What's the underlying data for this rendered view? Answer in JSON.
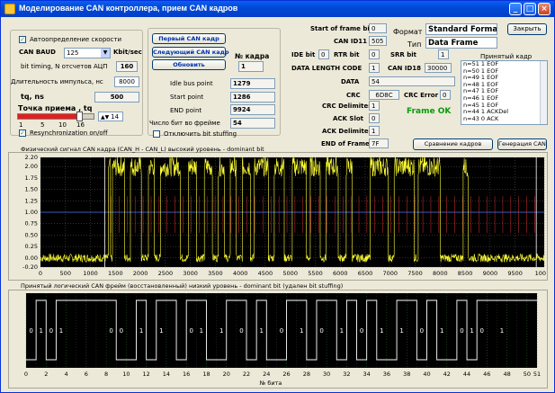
{
  "window": {
    "title": "Моделирование CAN контроллера, прием CAN кадров",
    "controls": {
      "minimize": "_",
      "maximize": "□",
      "close": "×"
    }
  },
  "left_panel": {
    "auto_speed_label": "Автоопределение скорости",
    "auto_speed_checked": true,
    "baud_label": "CAN BAUD",
    "baud_value": "125",
    "baud_unit": "Kbit/sec",
    "bit_timing_label": "bit timing, N отсчетов АЦП",
    "bit_timing_value": "160",
    "pulse_len_label": "Длительность импульса, нс",
    "pulse_len_value": "8000",
    "tq_label": "tq, ns",
    "tq_value": "500",
    "sample_point_label": "Точка приема , tq",
    "sample_point_value": "14",
    "slider_fraction": 0.81,
    "slider_ticks": [
      "1",
      "5",
      "10",
      "16"
    ],
    "resync_label": "Resynchronization on/off",
    "resync_checked": true
  },
  "frame_nav": {
    "first_frame": "Первый CAN кадр",
    "next_frame": "Следующий CAN кадр",
    "refresh": "Обновить",
    "frame_no_label": "№ кадра",
    "frame_no_value": "1",
    "idle_label": "Idle bus point",
    "idle_value": "1279",
    "start_label": "Start point",
    "start_value": "1286",
    "end_label": "END point",
    "end_value": "9924",
    "stuff_count_label": "Число бит во фрейме",
    "stuff_count_value": "54",
    "disable_stuffing_label": "Отключить bit stuffing",
    "disable_stuffing_checked": false
  },
  "frame_fields": {
    "sof_label": "Start of frame bit",
    "sof_value": "0",
    "id11_label": "CAN ID11",
    "id11_value": "505",
    "ide_label": "IDE bit",
    "ide_value": "0",
    "rtr_label": "RTR bit",
    "rtr_value": "0",
    "srr_label": "SRR bit",
    "srr_value": "1",
    "dlc_label": "DATA LENGTH CODE",
    "dlc_value": "1",
    "id18_label": "CAN ID18",
    "id18_value": "30000",
    "data_label": "DATA",
    "data_value": "54",
    "crc_label": "CRC",
    "crc_value": "6D8C",
    "crc_error_label": "CRC Error",
    "crc_error_value": "0",
    "crc_delim_label": "CRC Delimiter",
    "crc_delim_value": "1",
    "ack_slot_label": "ACK Slot",
    "ack_slot_value": "0",
    "ack_delim_label": "ACK Delimiter",
    "ack_delim_value": "1",
    "eof_label": "END of Frame",
    "eof_value": "7F",
    "format_label": "Формат",
    "format_value": "Standard Format",
    "type_label": "Тип",
    "type_value": "Data Frame",
    "status": "Frame OK"
  },
  "right_panel": {
    "close_button": "Закрыть",
    "received_label": "Принятый кадр",
    "received_rows": [
      "n=51 1 EOF",
      "n=50 1 EOF",
      "n=49 1 EOF",
      "n=48 1 EOF",
      "n=47 1 EOF",
      "n=46 1 EOF",
      "n=45 1 EOF",
      "n=44 1 ACKDel",
      "n=43 0 ACK"
    ],
    "compare_button": "Сравнение кадров",
    "generate_button": "Генерация CAN"
  },
  "chart_data": [
    {
      "type": "line",
      "title": "Физический сигнал  CAN кадра (CAN_H - CAN_L)  высокий уровень - dominant bit",
      "x_ticks": [
        "0",
        "500",
        "1000",
        "1500",
        "2000",
        "2500",
        "3000",
        "3500",
        "4000",
        "4500",
        "5000",
        "5500",
        "6000",
        "6500",
        "7000",
        "7500",
        "8000",
        "8500",
        "9000",
        "9500",
        "10083"
      ],
      "y_ticks": [
        "2.20",
        "2.00",
        "1.75",
        "1.50",
        "1.25",
        "1.00",
        "0.75",
        "0.50",
        "0.25",
        "0.00",
        "-0.20"
      ],
      "xlim": [
        0,
        10083
      ],
      "ylim": [
        -0.2,
        2.2
      ],
      "dominant_level": 2.0,
      "recessive_level": 0.0,
      "threshold_level": 1.0,
      "segments": [
        [
          0,
          0
        ],
        [
          1360,
          2
        ],
        [
          1400,
          0
        ],
        [
          1440,
          2
        ],
        [
          1680,
          0
        ],
        [
          1800,
          2
        ],
        [
          2020,
          0
        ],
        [
          2160,
          2
        ],
        [
          2280,
          0
        ],
        [
          2400,
          2
        ],
        [
          2800,
          0
        ],
        [
          2960,
          2
        ],
        [
          3120,
          0
        ],
        [
          3280,
          2
        ],
        [
          3440,
          0
        ],
        [
          3560,
          2
        ],
        [
          3680,
          0
        ],
        [
          3800,
          2
        ],
        [
          3920,
          0
        ],
        [
          4040,
          2
        ],
        [
          4200,
          0
        ],
        [
          4280,
          2
        ],
        [
          4560,
          0
        ],
        [
          4680,
          2
        ],
        [
          4880,
          0
        ],
        [
          5040,
          2
        ],
        [
          5320,
          0
        ],
        [
          5400,
          2
        ],
        [
          5600,
          0
        ],
        [
          5720,
          2
        ],
        [
          5960,
          0
        ],
        [
          6120,
          2
        ],
        [
          6240,
          0
        ],
        [
          6600,
          2
        ],
        [
          6960,
          0
        ],
        [
          7080,
          2
        ],
        [
          7480,
          0
        ],
        [
          7560,
          2
        ],
        [
          8000,
          0
        ],
        [
          8460,
          2
        ],
        [
          8560,
          0
        ],
        [
          10083,
          0
        ]
      ],
      "grid": true
    },
    {
      "type": "line",
      "title": "Принятый логический CAN фрейм (восстановленный) низкий уровень - dominant bit (удален bit stuffing)",
      "xlabel": "№ бита",
      "x_ticks": [
        "0",
        "2",
        "4",
        "6",
        "8",
        "10",
        "12",
        "14",
        "16",
        "18",
        "20",
        "22",
        "24",
        "26",
        "28",
        "30",
        "32",
        "34",
        "36",
        "38",
        "40",
        "42",
        "44",
        "46",
        "48",
        "50",
        "51"
      ],
      "xlim": [
        0,
        51
      ],
      "bits": [
        0,
        1,
        0,
        1,
        1,
        1,
        1,
        1,
        1,
        0,
        0,
        1,
        0,
        1,
        1,
        0,
        1,
        1,
        0,
        0,
        1,
        1,
        0,
        1,
        0,
        0,
        1,
        1,
        0,
        1,
        1,
        0,
        1,
        0,
        1,
        0,
        0,
        1,
        1,
        0,
        1,
        0,
        0,
        1,
        0,
        1,
        1,
        1,
        1,
        1,
        1,
        1
      ],
      "bit_labels_visible": [
        "0",
        "1",
        "0",
        "1",
        "0",
        "0",
        "1",
        "1",
        "0",
        "1",
        "1",
        "0",
        "1",
        "0",
        "1",
        "0",
        "1",
        "0",
        "1",
        "1",
        "0",
        "1",
        "0",
        "1",
        "0",
        "1"
      ],
      "grid": true
    }
  ],
  "colors": {
    "plot_bg": "#000000",
    "signal": "#ffff33",
    "threshold": "#3c78ff",
    "grid": "#606060",
    "frame_line": "#ffffff",
    "marker_red": "#e03030",
    "title_blue": "#0047d6"
  }
}
